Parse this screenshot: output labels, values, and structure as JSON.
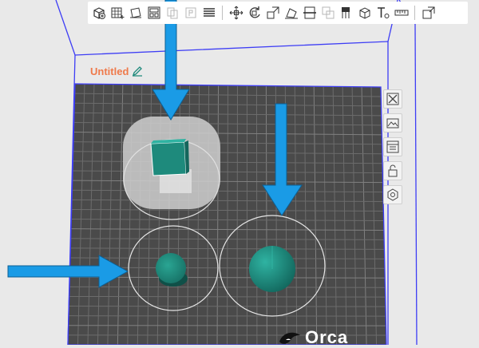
{
  "project": {
    "title": "Untitled"
  },
  "plate": {
    "logo_text": "Orca"
  },
  "toolbar": {
    "buttons": [
      {
        "name": "add-object-icon"
      },
      {
        "name": "add-plate-icon"
      },
      {
        "name": "orient-icon"
      },
      {
        "name": "arrange-icon"
      },
      {
        "name": "split-objects-icon"
      },
      {
        "name": "split-parts-icon"
      },
      {
        "name": "layers-icon"
      },
      {
        "name": "move-icon"
      },
      {
        "name": "rotate-icon"
      },
      {
        "name": "scale-icon"
      },
      {
        "name": "lay-on-face-icon"
      },
      {
        "name": "cut-icon"
      },
      {
        "name": "boolean-icon"
      },
      {
        "name": "paint-support-icon"
      },
      {
        "name": "seam-painting-icon"
      },
      {
        "name": "text-emboss-icon"
      },
      {
        "name": "measure-icon"
      },
      {
        "name": "assembly-view-icon"
      }
    ]
  },
  "side_toolbar": [
    "close-icon",
    "camera-view-icon",
    "plate-settings-icon",
    "lock-icon",
    "settings-icon"
  ],
  "colors": {
    "plate": "#4a4a4a",
    "grid": "#6a6a6a",
    "volume_edge": "#3d3df5",
    "model": "#1e8a7c",
    "arrow": "#1a9be6",
    "title": "#ef7a4b"
  }
}
